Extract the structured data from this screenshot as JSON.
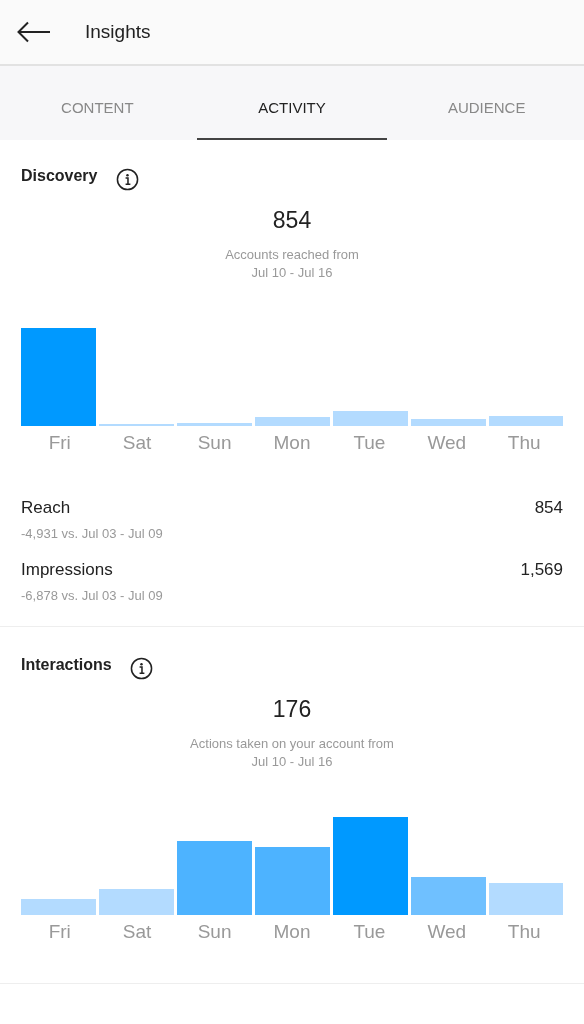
{
  "header": {
    "title": "Insights"
  },
  "tabs": [
    {
      "label": "CONTENT",
      "selected": false
    },
    {
      "label": "ACTIVITY",
      "selected": true
    },
    {
      "label": "AUDIENCE",
      "selected": false
    }
  ],
  "sections": [
    {
      "title": "Discovery",
      "total": "854",
      "caption": "Accounts reached from",
      "range": "Jul 10 - Jul 16",
      "days": [
        "Fri",
        "Sat",
        "Sun",
        "Mon",
        "Tue",
        "Wed",
        "Thu"
      ],
      "metrics": [
        {
          "label": "Reach",
          "value": "854",
          "comparison": "-4,931 vs. Jul 03 - Jul 09"
        },
        {
          "label": "Impressions",
          "value": "1,569",
          "comparison": "-6,878 vs. Jul 03 - Jul 09"
        }
      ]
    },
    {
      "title": "Interactions",
      "total": "176",
      "caption": "Actions taken on your account from",
      "range": "Jul 10 - Jul 16",
      "days": [
        "Fri",
        "Sat",
        "Sun",
        "Mon",
        "Tue",
        "Wed",
        "Thu"
      ]
    }
  ]
}
